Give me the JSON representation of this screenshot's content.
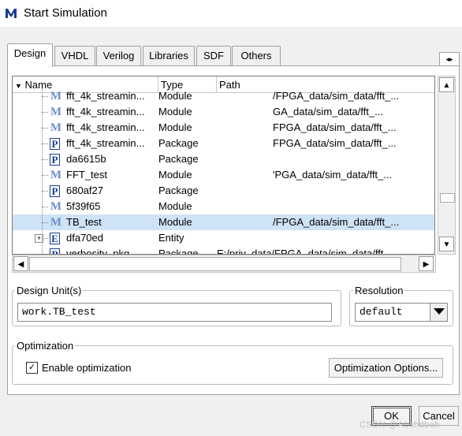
{
  "window": {
    "title": "Start Simulation",
    "app_icon": "modelsim-logo"
  },
  "tabs": [
    {
      "label": "Design",
      "active": true
    },
    {
      "label": "VHDL",
      "active": false
    },
    {
      "label": "Verilog",
      "active": false
    },
    {
      "label": "Libraries",
      "active": false
    },
    {
      "label": "SDF",
      "active": false
    },
    {
      "label": "Others",
      "active": false
    }
  ],
  "table": {
    "columns": [
      "Name",
      "Type",
      "Path"
    ],
    "rows": [
      {
        "icon": "module-icon",
        "name": "fft_4k_streamin...",
        "type": "Module",
        "path": "/FPGA_data/sim_data/fft_..."
      },
      {
        "icon": "module-icon",
        "name": "fft_4k_streamin...",
        "type": "Module",
        "path": "GA_data/sim_data/fft_..."
      },
      {
        "icon": "module-icon",
        "name": "fft_4k_streamin...",
        "type": "Module",
        "path": "FPGA_data/sim_data/fft_..."
      },
      {
        "icon": "package-icon",
        "name": "fft_4k_streamin...",
        "type": "Package",
        "path": "FPGA_data/sim_data/fft_..."
      },
      {
        "icon": "package-icon",
        "name": "da6615b",
        "type": "Package",
        "path": ""
      },
      {
        "icon": "module-icon",
        "name": "FFT_test",
        "type": "Module",
        "path": "'PGA_data/sim_data/fft_..."
      },
      {
        "icon": "package-icon",
        "name": "680af27",
        "type": "Package",
        "path": ""
      },
      {
        "icon": "module-icon",
        "name": "5f39f65",
        "type": "Module",
        "path": ""
      },
      {
        "icon": "module-icon",
        "name": "TB_test",
        "type": "Module",
        "path": "/FPGA_data/sim_data/fft_...",
        "selected": true
      },
      {
        "icon": "entity-icon",
        "name": "dfa70ed",
        "type": "Entity",
        "path": "",
        "expandable": true
      },
      {
        "icon": "package-icon",
        "name": "verbosity_pkg",
        "type": "Package",
        "path": "E:/priv_data/FPGA_data/sim_data/fft"
      }
    ]
  },
  "design_unit": {
    "label": "Design Unit(s)",
    "value": "work.TB_test"
  },
  "resolution": {
    "label": "Resolution",
    "value": "default"
  },
  "optimization": {
    "label": "Optimization",
    "checkbox_label": "Enable optimization",
    "checked": true,
    "options_button": "Optimization Options..."
  },
  "buttons": {
    "ok": "OK",
    "cancel": "Cancel"
  },
  "watermark": "CSDN @Abshdbeh"
}
